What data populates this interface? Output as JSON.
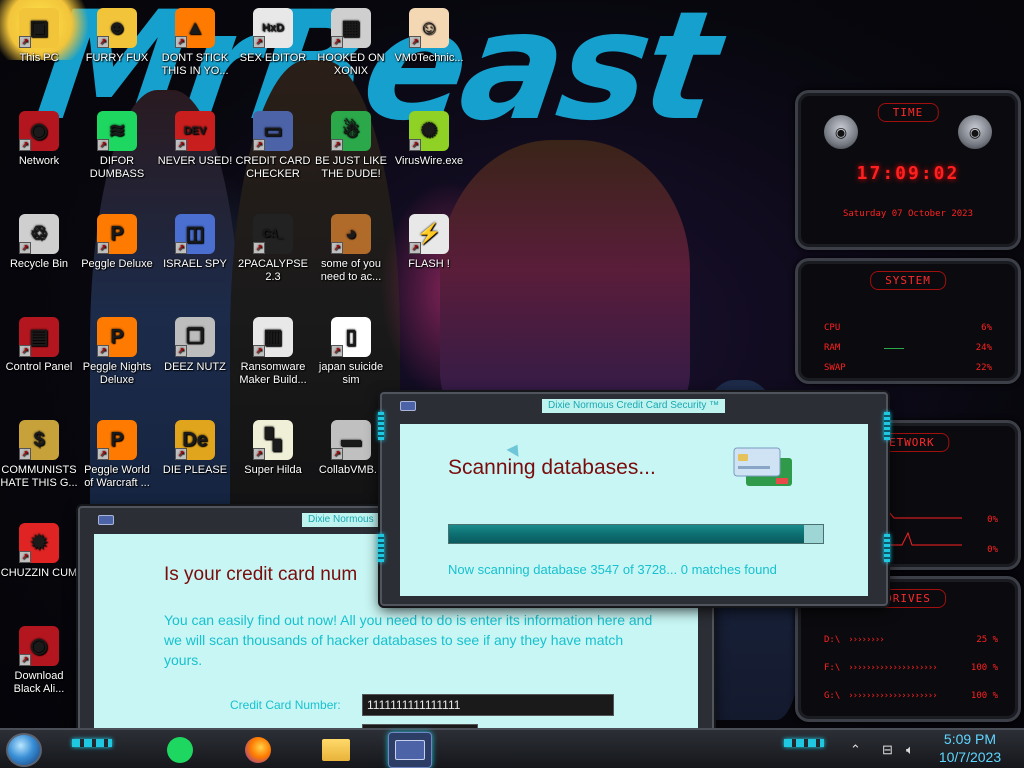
{
  "wallpaper": {
    "title": "MrBeast"
  },
  "desktop_icons": [
    {
      "label": "This PC",
      "icon": "computer-icon",
      "color": "#f2c43a"
    },
    {
      "label": "FURRY FUX",
      "icon": "cartoon-icon",
      "color": "#f2c43a"
    },
    {
      "label": "DONT STICK THIS IN YO...",
      "icon": "vlc-cone-icon",
      "color": "#ff7a00"
    },
    {
      "label": "SEX EDITOR",
      "icon": "hex-editor-icon",
      "color": "#e8e8e8"
    },
    {
      "label": "HOOKED ON XONIX",
      "icon": "xonix-game-icon",
      "color": "#cfcfcf"
    },
    {
      "label": "VM0Technic...",
      "icon": "doctor-icon",
      "color": "#f4d7b3"
    },
    {
      "label": "Network",
      "icon": "alien-orb-icon",
      "color": "#b3161f"
    },
    {
      "label": "DIFOR DUMBASS",
      "icon": "spotify-icon",
      "color": "#1ed760"
    },
    {
      "label": "NEVER USED!",
      "icon": "devcpp-icon",
      "color": "#c81e1e"
    },
    {
      "label": "CREDIT CARD CHECKER",
      "icon": "credit-card-icon",
      "color": "#4c63a8"
    },
    {
      "label": "BE JUST LIKE THE DUDE!",
      "icon": "santa-elf-icon",
      "color": "#2aa84a"
    },
    {
      "label": "VirusWire.exe",
      "icon": "lime-icon",
      "color": "#8fd124"
    },
    {
      "label": "Recycle Bin",
      "icon": "recycle-bin-icon",
      "color": "#cfcfcf"
    },
    {
      "label": "Peggle Deluxe",
      "icon": "peggle-icon",
      "color": "#ff7a00"
    },
    {
      "label": "ISRAEL SPY",
      "icon": "spy-window-icon",
      "color": "#4a6fd0"
    },
    {
      "label": "2PACALYPSE 2.3",
      "icon": "terminal-icon",
      "color": "#222222"
    },
    {
      "label": "some of you need to ac...",
      "icon": "beaver-icon",
      "color": "#b06a2a"
    },
    {
      "label": "FLASH !",
      "icon": "flash-icon",
      "color": "#e8e8e8"
    },
    {
      "label": "Control Panel",
      "icon": "control-panel-icon",
      "color": "#b3161f"
    },
    {
      "label": "Peggle Nights Deluxe",
      "icon": "peggle-icon",
      "color": "#ff7a00"
    },
    {
      "label": "DEEZ NUTZ",
      "icon": "windows-stack-icon",
      "color": "#bdbdbd"
    },
    {
      "label": "Ransomware Maker Build...",
      "icon": "app-window-icon",
      "color": "#e8e8e8"
    },
    {
      "label": "japan suicide sim",
      "icon": "document-icon",
      "color": "#ffffff"
    },
    {
      "label": "COMMUNISTS HATE THIS G...",
      "icon": "money-bag-icon",
      "color": "#c7a23a"
    },
    {
      "label": "Peggle World of Warcraft ...",
      "icon": "peggle-icon",
      "color": "#ff7a00"
    },
    {
      "label": "DIE PLEASE",
      "icon": "de-icon",
      "color": "#e0a51c"
    },
    {
      "label": "Super Hilda",
      "icon": "pixel-dog-icon",
      "color": "#f0f0d8"
    },
    {
      "label": "CollabVMB...",
      "icon": "monitor-icon",
      "color": "#c0c0c0"
    },
    {
      "label": "CHUZZIN CUM",
      "icon": "chuzzle-icon",
      "color": "#e02424"
    },
    {
      "label": "Download Black Ali...",
      "icon": "alien-orb-icon",
      "color": "#b3161f"
    }
  ],
  "widget": {
    "time_title": "TIME",
    "time": "17:09:02",
    "date": "Saturday 07 October 2023",
    "system_title": "SYSTEM",
    "cpu_label": "CPU",
    "cpu_value": "6%",
    "ram_label": "RAM",
    "ram_value": "24%",
    "swap_label": "SWAP",
    "swap_value": "22%",
    "network_title": "NETWORK",
    "net_up": "0%",
    "net_down": "0%",
    "drives_title": "DRIVES",
    "drives": [
      {
        "label": "D:\\",
        "value": "25 %"
      },
      {
        "label": "F:\\",
        "value": "100 %"
      },
      {
        "label": "G:\\",
        "value": "100 %"
      }
    ],
    "accent": "#ff2020"
  },
  "window_check": {
    "title": "Dixie Normous",
    "heading": "Is your credit card num",
    "description": "You can easily find out now! All you need to do is enter its information here and we will scan thousands of hacker databases to see if any they have match yours.",
    "cc_label": "Credit Card Number:",
    "cc_value": "1111111111111111"
  },
  "window_scan": {
    "title": "Dixie Normous Credit Card Security ™",
    "heading": "Scanning databases...",
    "progress": 0.95,
    "status": "Now scanning database 3547 of 3728... 0 matches found"
  },
  "taskbar": {
    "apps": [
      {
        "name": "spotify",
        "icon": "spotify-icon",
        "active": false
      },
      {
        "name": "firefox",
        "icon": "firefox-icon",
        "active": false
      },
      {
        "name": "file-explorer",
        "icon": "folder-icon",
        "active": false
      },
      {
        "name": "credit-card-checker",
        "icon": "credit-card-icon",
        "active": true
      }
    ],
    "time": "5:09 PM",
    "date": "10/7/2023"
  }
}
